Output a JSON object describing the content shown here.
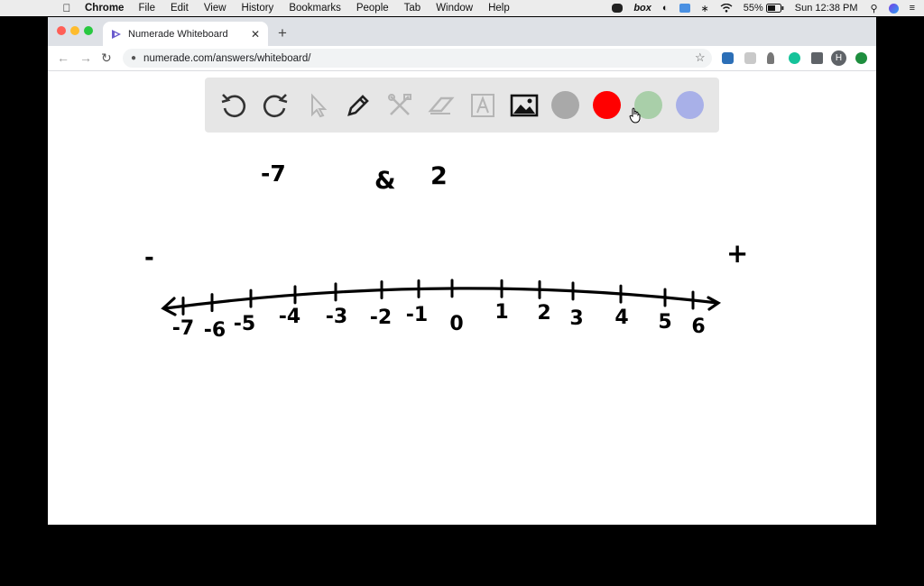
{
  "menubar": {
    "app_name": "Chrome",
    "menus": [
      "File",
      "Edit",
      "View",
      "History",
      "Bookmarks",
      "People",
      "Tab",
      "Window",
      "Help"
    ],
    "status": {
      "box": "box",
      "battery": "55%",
      "clock": "Sun 12:38 PM"
    }
  },
  "browser": {
    "tab_title": "Numerade Whiteboard",
    "new_tab_symbol": "+",
    "url": "numerade.com/answers/whiteboard/",
    "profile_initial": "H"
  },
  "whiteboard": {
    "tools": [
      "undo-icon",
      "redo-icon",
      "select-icon",
      "pen-icon",
      "tools-icon",
      "eraser-icon",
      "text-icon",
      "image-icon"
    ],
    "colors": [
      "#a9a9a9",
      "#ff0000",
      "#a9cfa9",
      "#a8b0e8"
    ],
    "notes": {
      "top_left": "-7",
      "top_middle": "&",
      "top_right": "2",
      "minus_sign": "-",
      "plus_sign": "+"
    },
    "number_line_labels": [
      "-7",
      "-6",
      "-5",
      "-4",
      "-3",
      "-2",
      "-1",
      "0",
      "1",
      "2",
      "3",
      "4",
      "5",
      "6"
    ]
  }
}
